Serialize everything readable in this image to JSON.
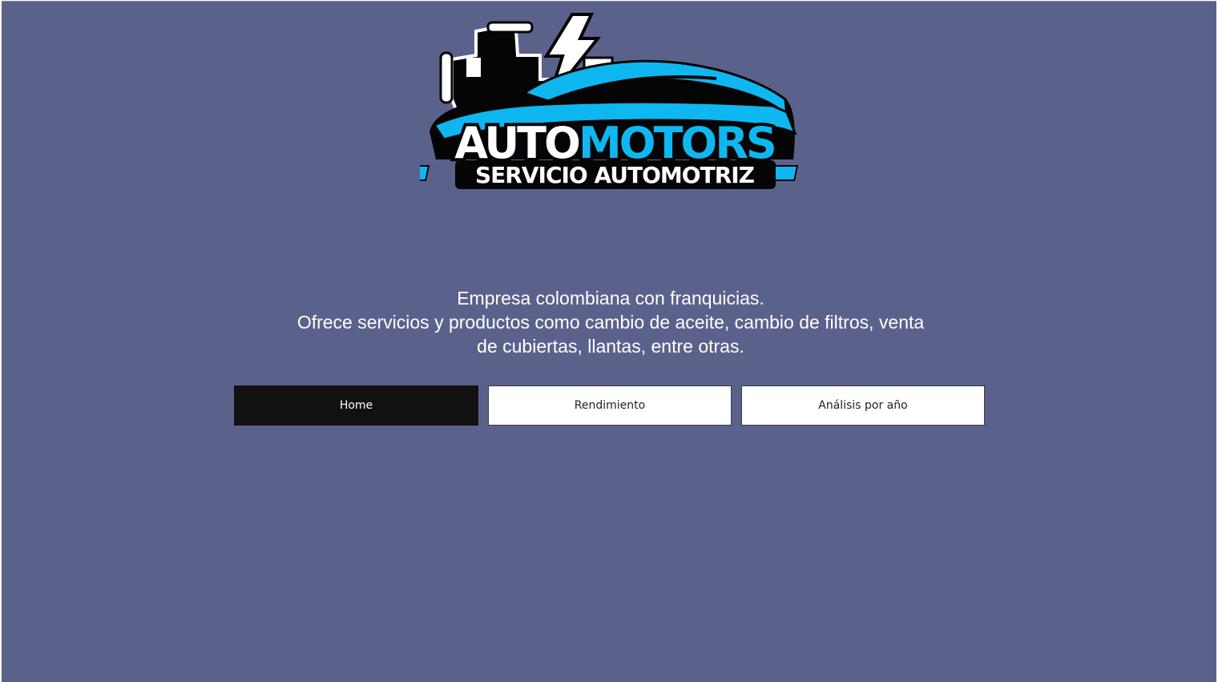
{
  "logo": {
    "brand_part1": "AUTO",
    "brand_part2": "MOTORS",
    "tagline": "SERVICIO AUTOMOTRIZ",
    "icon": "car-engine-logo-icon",
    "colors": {
      "brand_blue": "#0fb7f0",
      "outline": "#050505",
      "text_white": "#ffffff"
    }
  },
  "description": {
    "line1": "Empresa colombiana con franquicias.",
    "line2": "Ofrece servicios y productos como cambio de aceite, cambio de filtros, venta",
    "line3": "de cubiertas, llantas, entre otras."
  },
  "nav": {
    "items": [
      {
        "label": "Home",
        "active": true
      },
      {
        "label": "Rendimiento",
        "active": false
      },
      {
        "label": "Análisis por año",
        "active": false
      }
    ]
  },
  "colors": {
    "background": "#5a628c",
    "active_button": "#111112",
    "inactive_button": "#ffffff"
  }
}
